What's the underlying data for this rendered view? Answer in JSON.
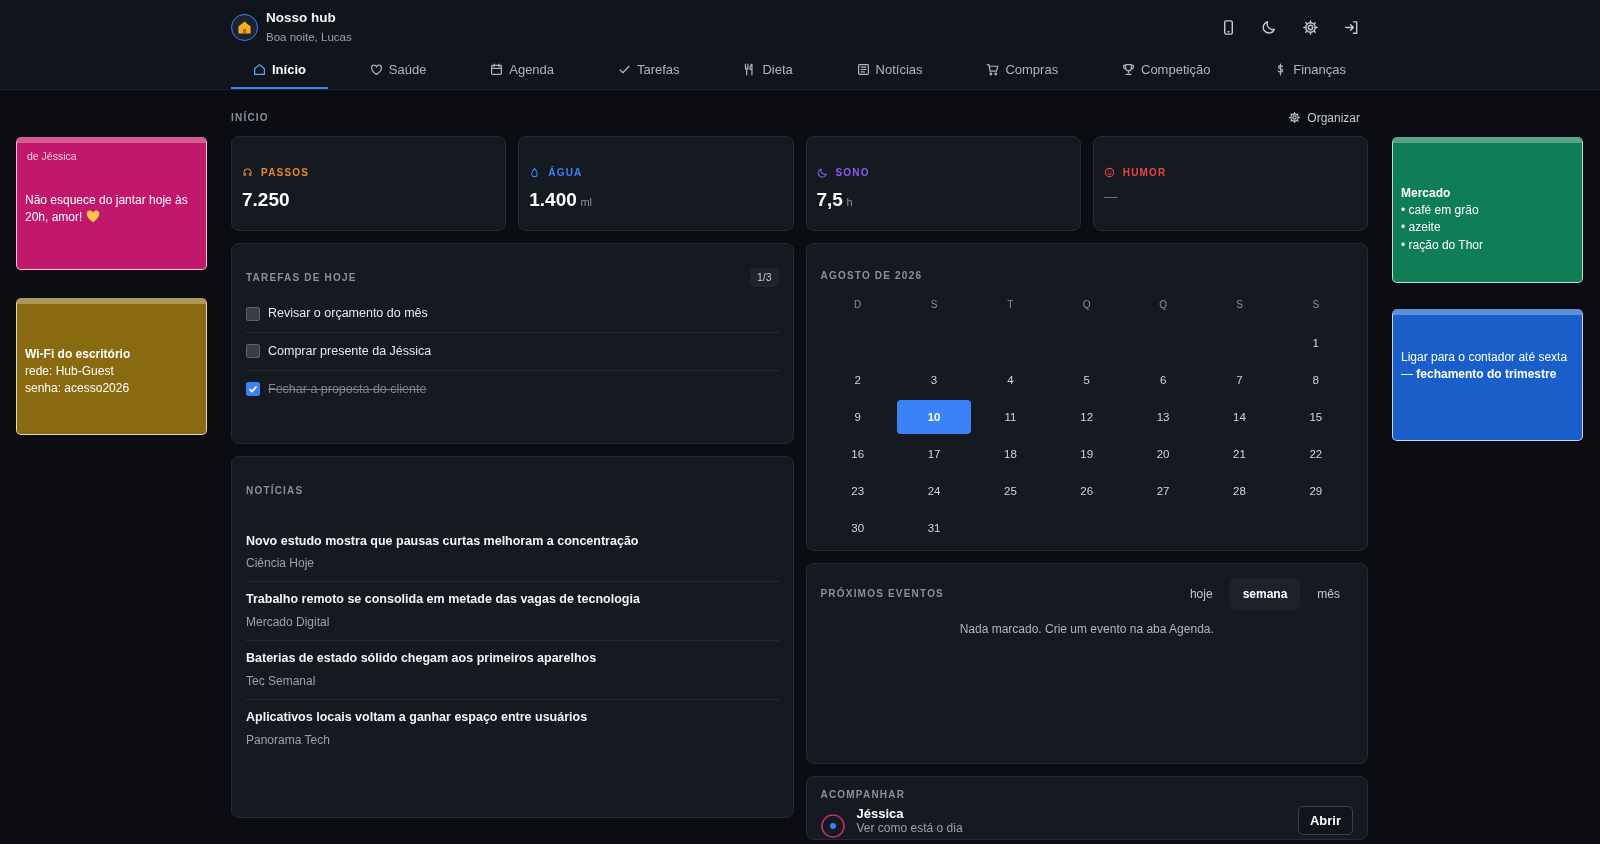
{
  "app": {
    "title": "Nosso hub",
    "greeting": "Boa noite, Lucas"
  },
  "tabs": [
    {
      "label": "Início",
      "selected": true
    },
    {
      "label": "Saúde",
      "selected": false
    },
    {
      "label": "Agenda",
      "selected": false
    },
    {
      "label": "Tarefas",
      "selected": false
    },
    {
      "label": "Dieta",
      "selected": false
    },
    {
      "label": "Notícias",
      "selected": false
    },
    {
      "label": "Compras",
      "selected": false
    },
    {
      "label": "Competição",
      "selected": false
    },
    {
      "label": "Finanças",
      "selected": false
    }
  ],
  "left_notes": [
    {
      "from": "de Jéssica",
      "lines": [
        "Não esquece do jantar hoje às 20h, amor!"
      ],
      "heart": true,
      "color": "#c2186b"
    },
    {
      "title": "Wi-Fi do escritório",
      "lines": [
        "rede: Hub-Guest",
        "senha: acesso2026"
      ],
      "color": "#8a6a10"
    }
  ],
  "right_notes": [
    {
      "title": "Mercado",
      "lines": [
        "• café em grão",
        "• azeite",
        "• ração do Thor"
      ],
      "color": "#0f7d55"
    },
    {
      "lines": [
        "Ligar para o contador até sexta — **fechamento do trimestre**"
      ],
      "color": "#1a5fc9"
    }
  ],
  "page": {
    "title": "INÍCIO",
    "action": "Organizar"
  },
  "stats": [
    {
      "label": "PASSOS",
      "value": "7.250",
      "color": "#e8892b"
    },
    {
      "label": "ÁGUA",
      "value": "1.400",
      "unit": "ml",
      "color": "#3b82f6"
    },
    {
      "label": "SONO",
      "value": "7,5",
      "unit": "h",
      "color": "#8b5cf6"
    },
    {
      "label": "HUMOR",
      "value": "—",
      "color": "#ef4444"
    }
  ],
  "tasks": {
    "title": "TAREFAS DE HOJE",
    "count": "1/3",
    "items": [
      {
        "label": "Revisar o orçamento do mês",
        "checked": false
      },
      {
        "label": "Comprar presente da Jéssica",
        "checked": false
      },
      {
        "label": "Fechar a proposta do cliente",
        "checked": true
      }
    ]
  },
  "news": {
    "title": "NOTÍCIAS",
    "items": [
      {
        "headline": "Novo estudo mostra que pausas curtas melhoram a concentração",
        "source": "Ciência Hoje"
      },
      {
        "headline": "Trabalho remoto se consolida em metade das vagas de tecnologia",
        "source": "Mercado Digital"
      },
      {
        "headline": "Baterias de estado sólido chegam aos primeiros aparelhos",
        "source": "Tec Semanal"
      },
      {
        "headline": "Aplicativos locais voltam a ganhar espaço entre usuários",
        "source": "Panorama Tech"
      }
    ]
  },
  "calendar": {
    "title": "AGOSTO DE 2026",
    "weekdays": [
      "D",
      "S",
      "T",
      "Q",
      "Q",
      "S",
      "S"
    ],
    "weeks": [
      [
        {
          "day": "1",
          "selected": false
        }
      ],
      [
        {
          "day": "2",
          "selected": false
        },
        {
          "day": "3",
          "selected": false
        },
        {
          "day": "4",
          "selected": false
        },
        {
          "day": "5",
          "selected": false
        },
        {
          "day": "6",
          "selected": false
        },
        {
          "day": "7",
          "selected": false
        },
        {
          "day": "8",
          "selected": false
        }
      ],
      [
        {
          "day": "9",
          "selected": false
        },
        {
          "day": "10",
          "selected": true
        },
        {
          "day": "11",
          "selected": false
        },
        {
          "day": "12",
          "selected": false
        },
        {
          "day": "13",
          "selected": false
        },
        {
          "day": "14",
          "selected": false
        },
        {
          "day": "15",
          "selected": false
        }
      ],
      [
        {
          "day": "16",
          "selected": false
        },
        {
          "day": "17",
          "selected": false
        },
        {
          "day": "18",
          "selected": false
        },
        {
          "day": "19",
          "selected": false
        },
        {
          "day": "20",
          "selected": false
        },
        {
          "day": "21",
          "selected": false
        },
        {
          "day": "22",
          "selected": false
        }
      ],
      [
        {
          "day": "23",
          "selected": false
        },
        {
          "day": "24",
          "selected": false
        },
        {
          "day": "25",
          "selected": false
        },
        {
          "day": "26",
          "selected": false
        },
        {
          "day": "27",
          "selected": false
        },
        {
          "day": "28",
          "selected": false
        },
        {
          "day": "29",
          "selected": false
        }
      ],
      [
        {
          "day": "30",
          "selected": false
        },
        {
          "day": "31",
          "selected": false
        }
      ]
    ]
  },
  "events": {
    "title": "PRÓXIMOS EVENTOS",
    "filters": [
      {
        "label": "hoje",
        "selected": false
      },
      {
        "label": "semana",
        "selected": true
      },
      {
        "label": "mês",
        "selected": false
      }
    ],
    "empty": "Nada marcado. Crie um evento na aba Agenda."
  },
  "follow": {
    "title": "ACOMPANHAR",
    "people": [
      {
        "name": "Jéssica",
        "subtitle": "Ver como está o dia",
        "button": "Abrir"
      }
    ]
  }
}
